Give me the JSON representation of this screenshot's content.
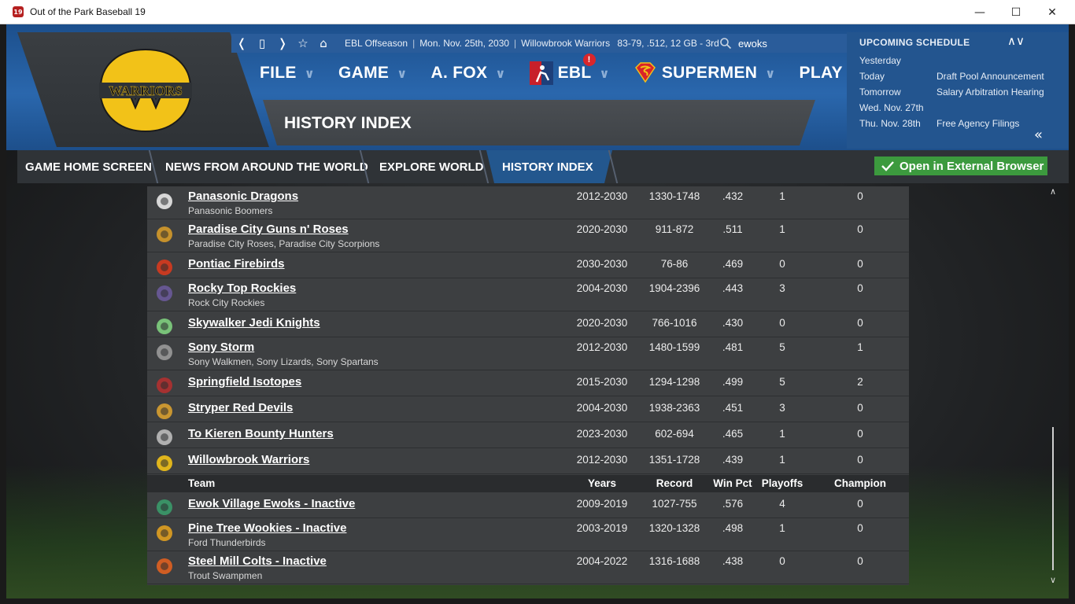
{
  "window": {
    "app_icon_text": "19",
    "title": "Out of the Park Baseball 19",
    "minimize": "—",
    "maximize": "☐",
    "close": "✕"
  },
  "info_bar": {
    "back": "❬",
    "page": "▯",
    "forward": "❭",
    "favorite": "☆",
    "home": "⌂",
    "season": "EBL Offseason",
    "date": "Mon. Nov. 25th, 2030",
    "team": "Willowbrook Warriors",
    "record": "83-79, .512, 12 GB - 3rd",
    "search_value": "ewoks"
  },
  "menu": {
    "file": "FILE",
    "game": "GAME",
    "manager": "A. FOX",
    "league": "EBL",
    "league_badge": "!",
    "team": "SUPERMEN",
    "play": "PLAY",
    "chevron": "∨"
  },
  "page_title": "HISTORY INDEX",
  "schedule": {
    "title": "UPCOMING SCHEDULE",
    "arrows": "∧∨",
    "collapse": "«",
    "items": [
      {
        "day": "Yesterday",
        "event": ""
      },
      {
        "day": "Today",
        "event": "Draft Pool Announcement"
      },
      {
        "day": "Tomorrow",
        "event": "Salary Arbitration Hearing"
      },
      {
        "day": "Wed. Nov. 27th",
        "event": ""
      },
      {
        "day": "Thu. Nov. 28th",
        "event": "Free Agency Filings"
      }
    ]
  },
  "tabs": {
    "home": "GAME HOME SCREEN",
    "news": "NEWS FROM AROUND THE WORLD",
    "explore": "EXPLORE WORLD",
    "history": "HISTORY INDEX"
  },
  "external_browser": "Open in External Browser",
  "logo_text": "WARRIORS",
  "table": {
    "headers": {
      "team": "Team",
      "years": "Years",
      "record": "Record",
      "win_pct": "Win Pct",
      "playoffs": "Playoffs",
      "champion": "Champion"
    },
    "active_rows": [
      {
        "name": "Panasonic Dragons",
        "alias": "Panasonic Boomers",
        "years": "2012-2030",
        "record": "1330-1748",
        "pct": ".432",
        "playoffs": "1",
        "champ": "0",
        "icon_color": "#e8e8e8"
      },
      {
        "name": "Paradise City Guns n' Roses",
        "alias": "Paradise City Roses, Paradise City Scorpions",
        "years": "2020-2030",
        "record": "911-872",
        "pct": ".511",
        "playoffs": "1",
        "champ": "0",
        "icon_color": "#d49a2a"
      },
      {
        "name": "Pontiac Firebirds",
        "alias": "",
        "years": "2030-2030",
        "record": "76-86",
        "pct": ".469",
        "playoffs": "0",
        "champ": "0",
        "icon_color": "#d63a1e"
      },
      {
        "name": "Rocky Top Rockies",
        "alias": "Rock City Rockies",
        "years": "2004-2030",
        "record": "1904-2396",
        "pct": ".443",
        "playoffs": "3",
        "champ": "0",
        "icon_color": "#6a5a9a"
      },
      {
        "name": "Skywalker Jedi Knights",
        "alias": "",
        "years": "2020-2030",
        "record": "766-1016",
        "pct": ".430",
        "playoffs": "0",
        "champ": "0",
        "icon_color": "#7fd07f"
      },
      {
        "name": "Sony Storm",
        "alias": "Sony Walkmen, Sony Lizards, Sony Spartans",
        "years": "2012-2030",
        "record": "1480-1599",
        "pct": ".481",
        "playoffs": "5",
        "champ": "1",
        "icon_color": "#9a9a9a"
      },
      {
        "name": "Springfield Isotopes",
        "alias": "",
        "years": "2015-2030",
        "record": "1294-1298",
        "pct": ".499",
        "playoffs": "5",
        "champ": "2",
        "icon_color": "#b03030"
      },
      {
        "name": "Stryper Red Devils",
        "alias": "",
        "years": "2004-2030",
        "record": "1938-2363",
        "pct": ".451",
        "playoffs": "3",
        "champ": "0",
        "icon_color": "#d8a030"
      },
      {
        "name": "To Kieren Bounty Hunters",
        "alias": "",
        "years": "2023-2030",
        "record": "602-694",
        "pct": ".465",
        "playoffs": "1",
        "champ": "0",
        "icon_color": "#bdbdbd"
      },
      {
        "name": "Willowbrook Warriors",
        "alias": "",
        "years": "2012-2030",
        "record": "1351-1728",
        "pct": ".439",
        "playoffs": "1",
        "champ": "0",
        "icon_color": "#f2c218"
      }
    ],
    "inactive_rows": [
      {
        "name": "Ewok Village Ewoks - Inactive",
        "alias": "",
        "years": "2009-2019",
        "record": "1027-755",
        "pct": ".576",
        "playoffs": "4",
        "champ": "0",
        "icon_color": "#3a9a6a"
      },
      {
        "name": "Pine Tree Wookies - Inactive",
        "alias": "Ford Thunderbirds",
        "years": "2003-2019",
        "record": "1320-1328",
        "pct": ".498",
        "playoffs": "1",
        "champ": "0",
        "icon_color": "#e0a020"
      },
      {
        "name": "Steel Mill Colts - Inactive",
        "alias": "Trout Swampmen",
        "years": "2004-2022",
        "record": "1316-1688",
        "pct": ".438",
        "playoffs": "0",
        "champ": "0",
        "icon_color": "#e06020"
      }
    ]
  },
  "scrollbar": {
    "up": "∧",
    "down": "∨"
  },
  "colors": {
    "header_blue": "#2a67ad",
    "tab_active": "#23578e",
    "button_green": "#3c9a3e",
    "logo_yellow": "#f2c218",
    "badge_red": "#d9262b"
  }
}
